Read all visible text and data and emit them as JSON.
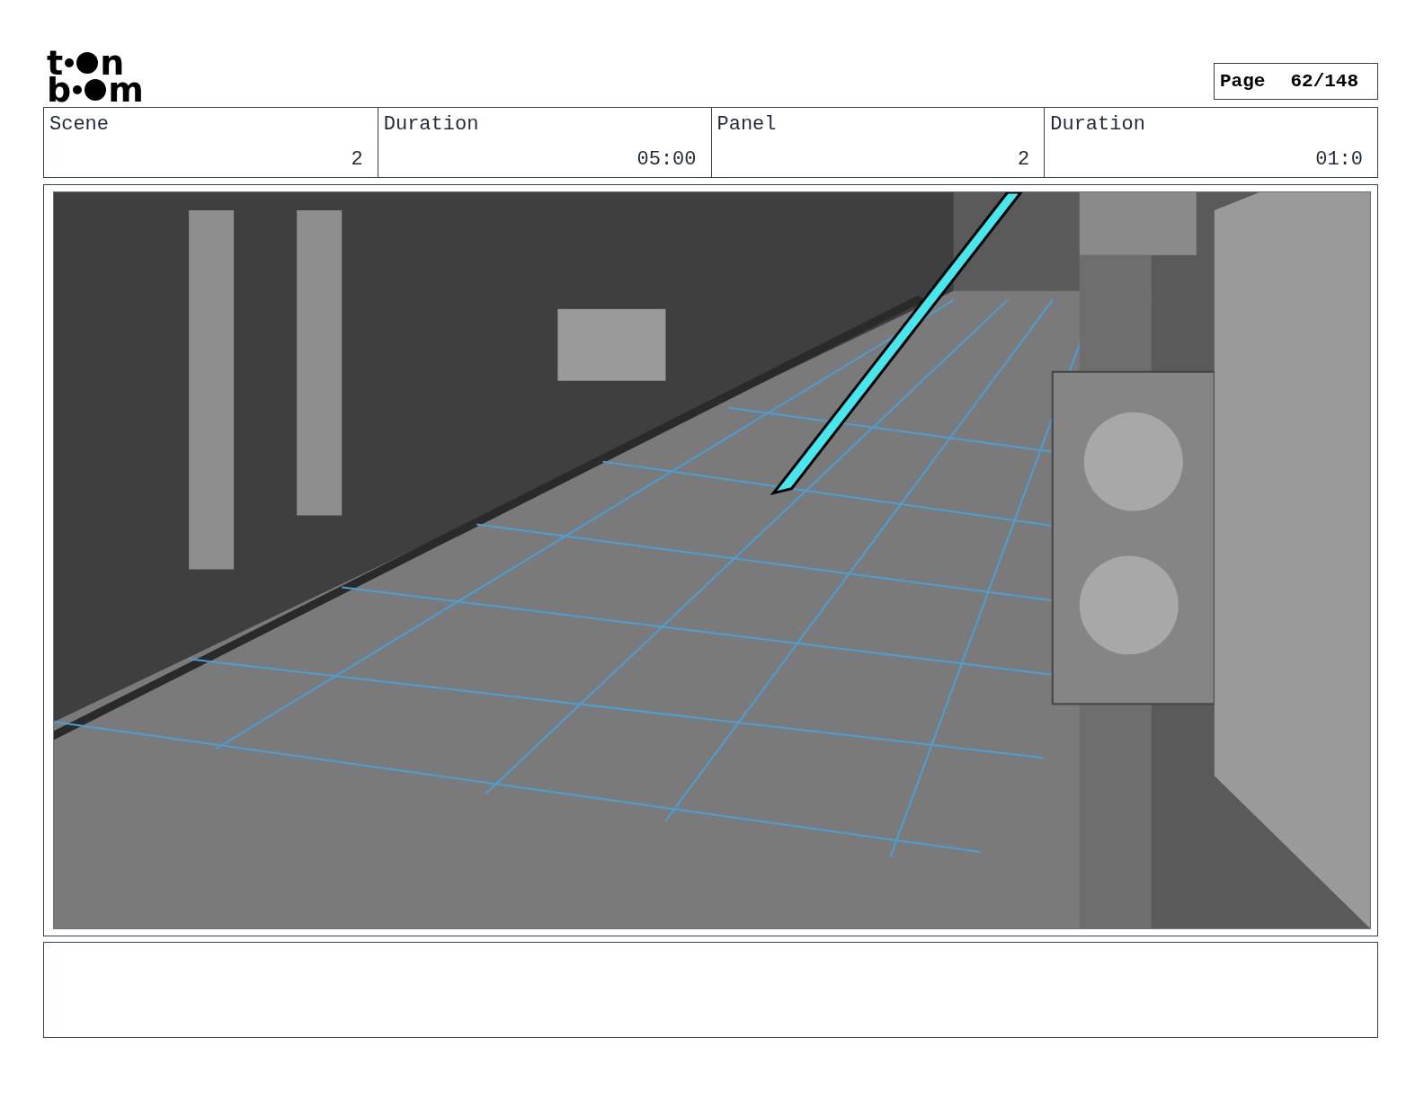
{
  "logo": {
    "line_1": [
      "t",
      "n"
    ],
    "line_2": [
      "b",
      "m"
    ]
  },
  "page": {
    "label": "Page",
    "value": "62/148"
  },
  "header": [
    {
      "label": "Scene",
      "value": "2"
    },
    {
      "label": "Duration",
      "value": "05:00"
    },
    {
      "label": "Panel",
      "value": "2"
    },
    {
      "label": "Duration",
      "value": "01:0"
    }
  ]
}
